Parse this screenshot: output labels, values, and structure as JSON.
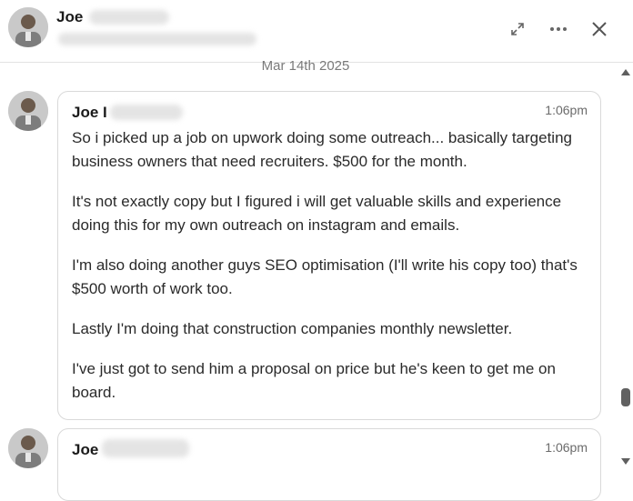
{
  "header": {
    "name": "Joe",
    "icons": [
      "expand-icon",
      "more-icon",
      "close-icon"
    ]
  },
  "date_separator": "Mar 14th 2025",
  "messages": [
    {
      "sender": "Joe I",
      "time": "1:06pm",
      "paragraphs": [
        "So i picked up a job on upwork doing some outreach... basically targeting business owners that need recruiters. $500 for the month.",
        "It's not exactly copy but I figured i will get valuable skills and experience doing this for my own outreach on instagram and emails.",
        "I'm also doing another guys SEO optimisation (I'll write his copy too) that's $500 worth of work too.",
        "Lastly I'm doing that construction companies monthly newsletter.",
        "I've just got to send him a proposal on price but he's keen to get me on board."
      ]
    },
    {
      "sender": "Joe",
      "time": "1:06pm"
    }
  ],
  "colors": {
    "border": "#d9d9d9",
    "muted": "#6b6b6b"
  }
}
